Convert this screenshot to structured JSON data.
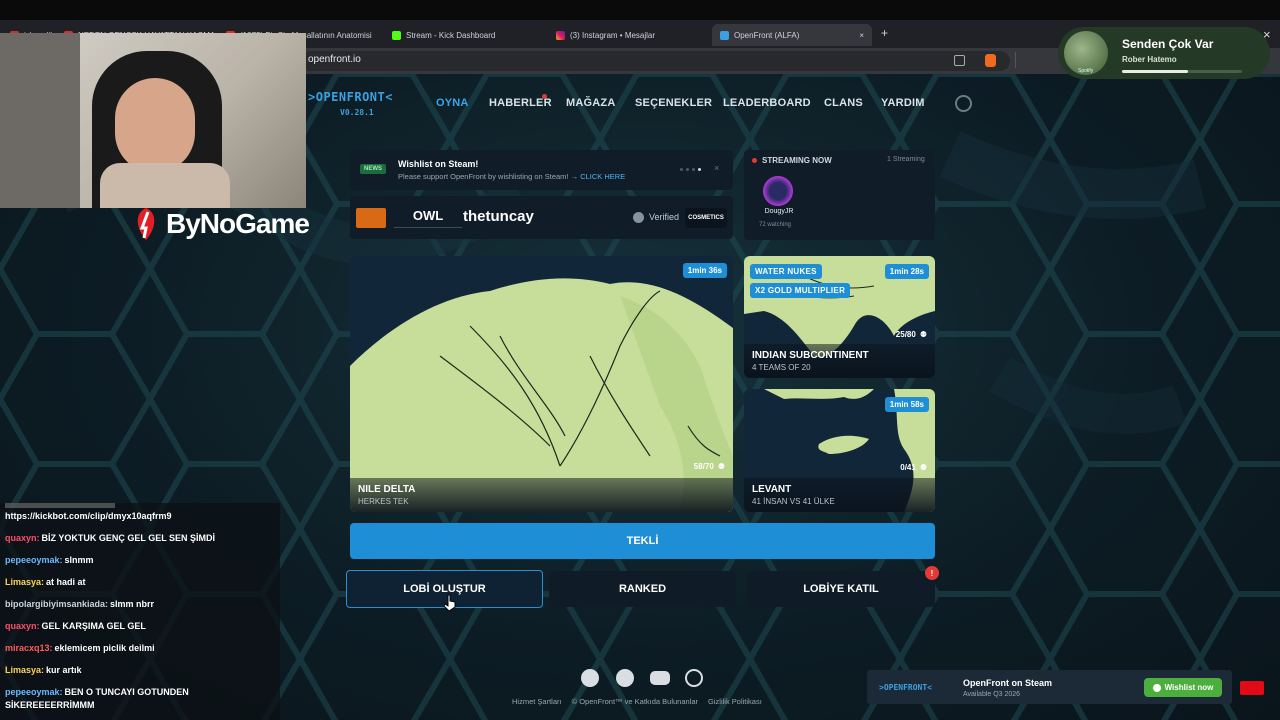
{
  "browser": {
    "tabs": [
      {
        "label": "islamslik"
      },
      {
        "label": "NEDEN GENÇSK HAYATTAN KAÇMAK"
      },
      {
        "label": "(1073) Bir Cin Musallatının Anatomisi"
      },
      {
        "label": "Stream - Kick Dashboard"
      },
      {
        "label": "(3) Instagram • Mesajlar"
      },
      {
        "label": "OpenFront (ALFA)"
      }
    ],
    "new_tab": "+",
    "close_tab": "×",
    "url": "openfront.io"
  },
  "notification": {
    "title": "Senden Çok Var",
    "artist": "Rober Hatemo",
    "source": "Spotify",
    "close": "×",
    "progress": 0.55
  },
  "overlay": {
    "brand": "ByNoGame"
  },
  "site": {
    "logo": ">OPENFRONT<",
    "version": "V0.28.1",
    "nav": [
      "OYNA",
      "HABERLER",
      "MAĞAZA",
      "SEÇENEKLER",
      "LEADERBOARD",
      "CLANS",
      "YARDIM"
    ]
  },
  "news": {
    "badge": "NEWS",
    "title": "Wishlist on Steam!",
    "text": "Please support OpenFront by wishlisting on Steam! →",
    "link": "CLICK HERE"
  },
  "streaming": {
    "title": "STREAMING NOW",
    "count": "1 Streaming",
    "streamer": "DougyJR",
    "watching": "72 watching"
  },
  "player": {
    "clan": "OWL",
    "username": "thetuncay",
    "verified": "Verified",
    "cosmetics": "COSMETICS"
  },
  "lobbies": [
    {
      "name": "NILE DELTA",
      "sub": "HERKES TEK",
      "timer": "1min 36s",
      "players": "58/70"
    },
    {
      "name": "INDIAN SUBCONTINENT",
      "sub": "4 TEAMS OF 20",
      "timer": "1min 28s",
      "players": "25/80",
      "tags": [
        "WATER NUKES",
        "X2 GOLD MULTIPLIER"
      ]
    },
    {
      "name": "LEVANT",
      "sub": "41 İNSAN VS 41 ÜLKE",
      "timer": "1min 58s",
      "players": "0/41"
    }
  ],
  "buttons": {
    "single": "TEKLİ",
    "create": "LOBİ OLUŞTUR",
    "ranked": "RANKED",
    "join": "LOBİYE KATIL",
    "join_badge": "!"
  },
  "footer": {
    "links": [
      "Hizmet Şartları",
      "© OpenFront™ ve Katkıda Bulunanlar",
      "Gizlilik Politikası"
    ],
    "steam_logo": ">OPENFRONT<",
    "steam_title": "OpenFront on Steam",
    "steam_sub": "Available Q3 2026",
    "wishlist": "Wishlist now"
  },
  "chat": [
    {
      "user": "",
      "msg": "https://kickbot.com/clip/dmyx10aqfrm9",
      "color": "#ffffff"
    },
    {
      "user": "quaxyn:",
      "msg": "BİZ YOKTUK GENÇ GEL GEL SEN ŞİMDİ",
      "color": "#ff4d6a"
    },
    {
      "user": "pepeeoymak:",
      "msg": "slnmm",
      "color": "#6fb7ff"
    },
    {
      "user": "Limasya:",
      "msg": "at hadi at",
      "color": "#ffd35c"
    },
    {
      "user": "bipolargibiyimsankiada:",
      "msg": "slmm nbrr",
      "color": "#c9d3dc"
    },
    {
      "user": "quaxyn:",
      "msg": "GEL KARŞIMA GEL GEL",
      "color": "#ff4d6a"
    },
    {
      "user": "miracxq13:",
      "msg": "eklemicem piclik deilmi",
      "color": "#ff5c5c"
    },
    {
      "user": "Limasya:",
      "msg": "kur artık",
      "color": "#ffd35c"
    },
    {
      "user": "pepeeoymak:",
      "msg": "BEN O TUNCAYI GOTUNDEN",
      "color": "#6fb7ff"
    },
    {
      "user": "",
      "msg": "SİKEREEEERRİMMM",
      "color": "#ffffff"
    }
  ]
}
